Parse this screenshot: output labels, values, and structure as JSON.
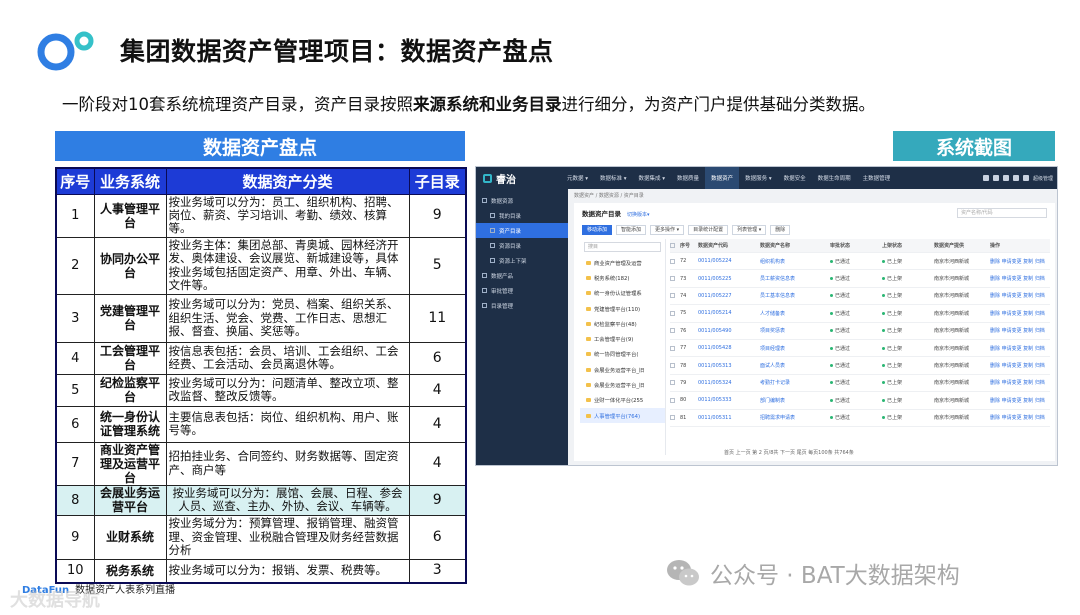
{
  "header": {
    "title": "集团数据资产管理项目：数据资产盘点",
    "subtitle_pre": "一阶段对10套系统梳理资产目录，资产目录按照",
    "subtitle_bold": "来源系统和业务目录",
    "subtitle_post": "进行细分，为资产门户提供基础分类数据。"
  },
  "left_banner": "数据资产盘点",
  "right_banner": "系统截图",
  "table": {
    "headers": [
      "序号",
      "业务系统",
      "数据资产分类",
      "子目录"
    ],
    "rows": [
      {
        "no": "1",
        "system": "人事管理平台",
        "category": "按业务域可以分为：员工、组织机构、招聘、岗位、薪资、学习培训、考勤、绩效、核算等。",
        "sub": "9"
      },
      {
        "no": "2",
        "system": "协同办公平台",
        "category": "按业务主体：集团总部、青奥城、园林经济开发、奥体建设、会议展览、新城建设等，具体按业务域包括固定资产、用章、外出、车辆、文件等。",
        "sub": "5"
      },
      {
        "no": "3",
        "system": "党建管理平台",
        "category": "按业务域可以分为：党员、档案、组织关系、组织生活、党会、党费、工作日志、思想汇报、督查、换届、奖惩等。",
        "sub": "11"
      },
      {
        "no": "4",
        "system": "工会管理平台",
        "category": "按信息表包括：会员、培训、工会组织、工会经费、工会活动、会员离退休等。",
        "sub": "6"
      },
      {
        "no": "5",
        "system": "纪检监察平台",
        "category": "按业务域可以分为：问题清单、整改立项、整改监督、整改反馈等。",
        "sub": "4"
      },
      {
        "no": "6",
        "system": "统一身份认证管理系统",
        "category": "主要信息表包括：岗位、组织机构、用户、账号等。",
        "sub": "4"
      },
      {
        "no": "7",
        "system": "商业资产管理及运营平台",
        "category": "招拍挂业务、合同签约、财务数据等、固定资产、商户等",
        "sub": "4"
      },
      {
        "no": "8",
        "system": "会展业务运营平台",
        "category": "按业务域可以分为：展馆、会展、日程、参会人员、巡查、主办、外协、会议、车辆等。",
        "sub": "9"
      },
      {
        "no": "9",
        "system": "业财系统",
        "category": "按业务域分为：预算管理、报销管理、融资管理、资金管理、业税融合管理及财务经营数据分析",
        "sub": "6"
      },
      {
        "no": "10",
        "system": "税务系统",
        "category": "按业务域可以分为：报销、发票、税费等。",
        "sub": "3"
      }
    ]
  },
  "source": {
    "brand": "DataFun",
    "text": "数据资产人表系列直播"
  },
  "watermark_left": "大数据导航",
  "watermark": "公众号 · BAT大数据架构",
  "screenshot": {
    "app_name": "睿治",
    "nav": [
      "元数据 ▾",
      "数据标准 ▾",
      "数据集成 ▾",
      "数据质量",
      "数据资产",
      "数据服务 ▾",
      "数据安全",
      "数据生命周期",
      "主数据管理"
    ],
    "nav_active": "数据资产",
    "user": "超级管理",
    "side": [
      {
        "label": "数据资源",
        "level": "top",
        "active": false
      },
      {
        "label": "我的目录",
        "level": "sub",
        "active": false
      },
      {
        "label": "资产目录",
        "level": "sub",
        "active": true
      },
      {
        "label": "资源目录",
        "level": "sub",
        "active": false
      },
      {
        "label": "资源上下架",
        "level": "sub",
        "active": false
      },
      {
        "label": "数据产品",
        "level": "top",
        "active": false
      },
      {
        "label": "审批管理",
        "level": "top",
        "active": false
      },
      {
        "label": "目录管理",
        "level": "top",
        "active": false
      }
    ],
    "breadcrumb": "数据资产 / 数据资源 / 资产目录",
    "panel_title": "数据资产目录",
    "panel_switch": "切换版本▾",
    "search_placeholder": "资产名称/代码",
    "actions": [
      "移动添加",
      "智能添加",
      "更多操作 ▾",
      "目录统计配置",
      "列表管理 ▾",
      "删除"
    ],
    "tree_search": "搜目",
    "tree": [
      {
        "label": "商业资产管理及运营",
        "active": false
      },
      {
        "label": "税务系统(182)",
        "active": false
      },
      {
        "label": "统一身份认证管理系",
        "active": false
      },
      {
        "label": "党建管理平台(110)",
        "active": false
      },
      {
        "label": "纪检监察平台(48)",
        "active": false
      },
      {
        "label": "工会管理平台(9)",
        "active": false
      },
      {
        "label": "统一协同管理平台(",
        "active": false
      },
      {
        "label": "会展业务运营平台_旧",
        "active": false
      },
      {
        "label": "会展业务运营平台_旧",
        "active": false
      },
      {
        "label": "业财一体化平台(255",
        "active": false
      },
      {
        "label": "人事管理平台(764)",
        "active": true
      }
    ],
    "grid_headers": [
      "序号",
      "数据资产代码",
      "数据资产名称",
      "审批状态",
      "上架状态",
      "数据资产提供",
      "操作"
    ],
    "grid_rows": [
      {
        "no": "72",
        "code": "0011/005224",
        "name": "组织机构表",
        "audit": "已通过",
        "shelf": "已上架",
        "src": "南京市河西新城",
        "op": "删除 申请变更 复制 归档"
      },
      {
        "no": "73",
        "code": "0011/005225",
        "name": "员工薪资信息表",
        "audit": "已通过",
        "shelf": "已上架",
        "src": "南京市河西新城",
        "op": "删除 申请变更 复制 归档"
      },
      {
        "no": "74",
        "code": "0011/005227",
        "name": "员工基本信息表",
        "audit": "已通过",
        "shelf": "已上架",
        "src": "南京市河西新城",
        "op": "删除 申请变更 复制 归档"
      },
      {
        "no": "75",
        "code": "0011/005214",
        "name": "人才储备表",
        "audit": "已通过",
        "shelf": "已上架",
        "src": "南京市河西新城",
        "op": "删除 申请变更 复制 归档"
      },
      {
        "no": "76",
        "code": "0011/005490",
        "name": "项目奖惩表",
        "audit": "已通过",
        "shelf": "已上架",
        "src": "南京市河西新城",
        "op": "删除 申请变更 复制 归档"
      },
      {
        "no": "77",
        "code": "0011/005428",
        "name": "项目经理表",
        "audit": "已通过",
        "shelf": "已上架",
        "src": "南京市河西新城",
        "op": "删除 申请变更 复制 归档"
      },
      {
        "no": "78",
        "code": "0011/005313",
        "name": "面试人员表",
        "audit": "已通过",
        "shelf": "已上架",
        "src": "南京市河西新城",
        "op": "删除 申请变更 复制 归档"
      },
      {
        "no": "79",
        "code": "0011/005324",
        "name": "考勤打卡记录",
        "audit": "已通过",
        "shelf": "已上架",
        "src": "南京市河西新城",
        "op": "删除 申请变更 复制 归档"
      },
      {
        "no": "80",
        "code": "0011/005333",
        "name": "部门编制表",
        "audit": "已通过",
        "shelf": "已上架",
        "src": "南京市河西新城",
        "op": "删除 申请变更 复制 归档"
      },
      {
        "no": "81",
        "code": "0011/005311",
        "name": "招聘需求申请表",
        "audit": "已通过",
        "shelf": "已上架",
        "src": "南京市河西新城",
        "op": "删除 申请变更 复制 归档"
      }
    ],
    "pager": "首页 上一页 第 2 页/8共 下一页 尾页 每页100条 共764条"
  }
}
